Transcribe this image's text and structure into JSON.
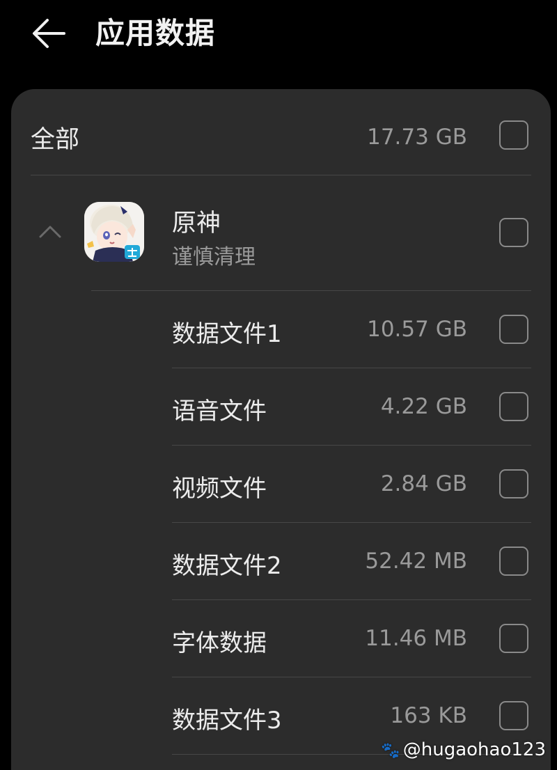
{
  "header": {
    "back_icon": "arrow-left-icon",
    "title": "应用数据"
  },
  "all": {
    "label": "全部",
    "size": "17.73 GB",
    "checked": false
  },
  "app": {
    "name": "原神",
    "subtitle": "谨慎清理",
    "icon": "app-avatar-icon",
    "expanded": true,
    "checked": false
  },
  "items": [
    {
      "label": "数据文件1",
      "size": "10.57 GB",
      "checked": false
    },
    {
      "label": "语音文件",
      "size": "4.22 GB",
      "checked": false
    },
    {
      "label": "视频文件",
      "size": "2.84 GB",
      "checked": false
    },
    {
      "label": "数据文件2",
      "size": "52.42 MB",
      "checked": false
    },
    {
      "label": "字体数据",
      "size": "11.46 MB",
      "checked": false
    },
    {
      "label": "数据文件3",
      "size": "163 KB",
      "checked": false
    }
  ],
  "watermark": "@hugaohao123",
  "colors": {
    "background": "#000000",
    "card": "#2c2c2c",
    "text_primary": "#ececec",
    "text_secondary": "#9a9a9a",
    "divider": "#474747",
    "checkbox_border": "#8a8a8a"
  }
}
